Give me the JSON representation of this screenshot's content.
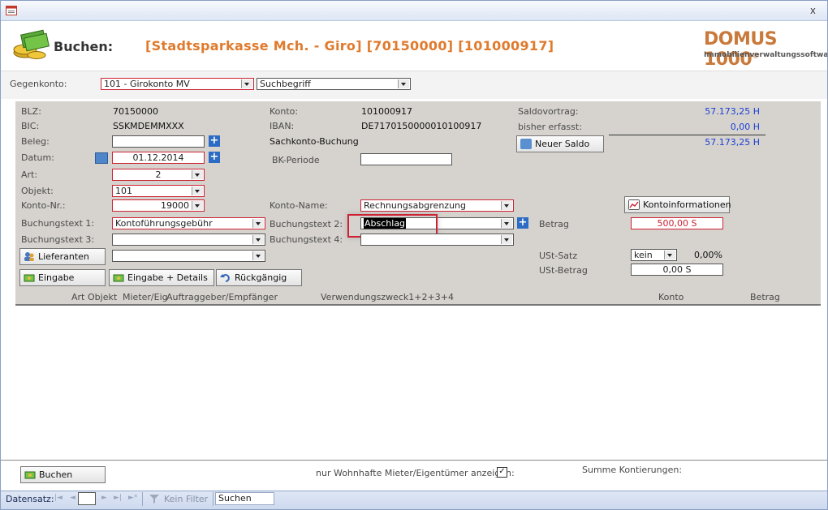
{
  "header": {
    "form_title": "Buchen:",
    "account_title": "[Stadtsparkasse Mch. - Giro] [70150000] [101000917]",
    "logo_main": "DOMUS 1000",
    "logo_reg": "®",
    "logo_sub": "Immobilienverwaltungssoftware",
    "close_glyph": "x"
  },
  "gegenkonto": {
    "label": "Gegenkonto:",
    "value": "101 - Girokonto MV",
    "search_value": "Suchbegriff"
  },
  "info": {
    "blz_label": "BLZ:",
    "blz_value": "70150000",
    "bic_label": "BIC:",
    "bic_value": "SSKMDEMMXXX",
    "konto_label": "Konto:",
    "konto_value": "101000917",
    "iban_label": "IBAN:",
    "iban_value": "DE7170150000010100917",
    "sachkonto_label": "Sachkonto-Buchung",
    "saldovortrag_label": "Saldovortrag:",
    "saldovortrag_value": "57.173,25 H",
    "bisher_label": "bisher erfasst:",
    "bisher_value": "0,00 H",
    "saldo_total": "57.173,25 H"
  },
  "form": {
    "beleg_label": "Beleg:",
    "beleg_value": "",
    "datum_label": "Datum:",
    "datum_value": "01.12.2014",
    "bk_label": "BK-Periode",
    "bk_value": "",
    "art_label": "Art:",
    "art_value": "2",
    "objekt_label": "Objekt:",
    "objekt_value": "101",
    "kontonr_label": "Konto-Nr.:",
    "kontonr_value": "19000",
    "kontoname_label": "Konto-Name:",
    "kontoname_value": "Rechnungsabgrenzung",
    "bt1_label": "Buchungstext 1:",
    "bt1_value": "Kontoführungsgebühr",
    "bt2_label": "Buchungstext 2:",
    "bt2_value": "Abschlag",
    "bt3_label": "Buchungstext 3:",
    "bt3_value": "",
    "bt4_label": "Buchungstext 4:",
    "bt4_value": "",
    "betrag_label": "Betrag",
    "betrag_value": "500,00 S",
    "ust_satz_label": "USt-Satz",
    "ust_satz_value": "kein",
    "ust_percent": "0,00%",
    "ust_betrag_label": "USt-Betrag",
    "ust_betrag_value": "0,00 S"
  },
  "buttons": {
    "neuer_saldo": "Neuer Saldo",
    "kontoinformationen": "Kontoinformationen",
    "lieferanten": "Lieferanten",
    "eingabe": "Eingabe",
    "eingabe_details": "Eingabe + Details",
    "rueckgaengig": "Rückgängig",
    "buchen": "Buchen"
  },
  "columns": {
    "art": "Art",
    "objekt": "Objekt",
    "mieter": "Mieter/Eig",
    "auftraggeber": "Auftraggeber/Empfänger",
    "verwendung": "Verwendungszweck1+2+3+4",
    "konto": "Konto",
    "betrag": "Betrag"
  },
  "footer": {
    "wohnhafte_label": "nur Wohnhafte Mieter/Eigentümer anzeigen:",
    "wohnhafte_checked": "✓",
    "summe_label": "Summe Kontierungen:"
  },
  "navbar": {
    "datensatz_label": "Datensatz:",
    "nav_first": "|◄",
    "nav_prev": "◄",
    "nav_next": "►",
    "nav_last": "►|",
    "nav_new": "►*",
    "kein_filter": "Kein Filter",
    "suchen": "Suchen"
  },
  "colors": {
    "accent_orange": "#e07a2c",
    "value_blue": "#1a3fd6",
    "required_red": "#cc2233",
    "panel_gray": "#d6d3ce"
  }
}
